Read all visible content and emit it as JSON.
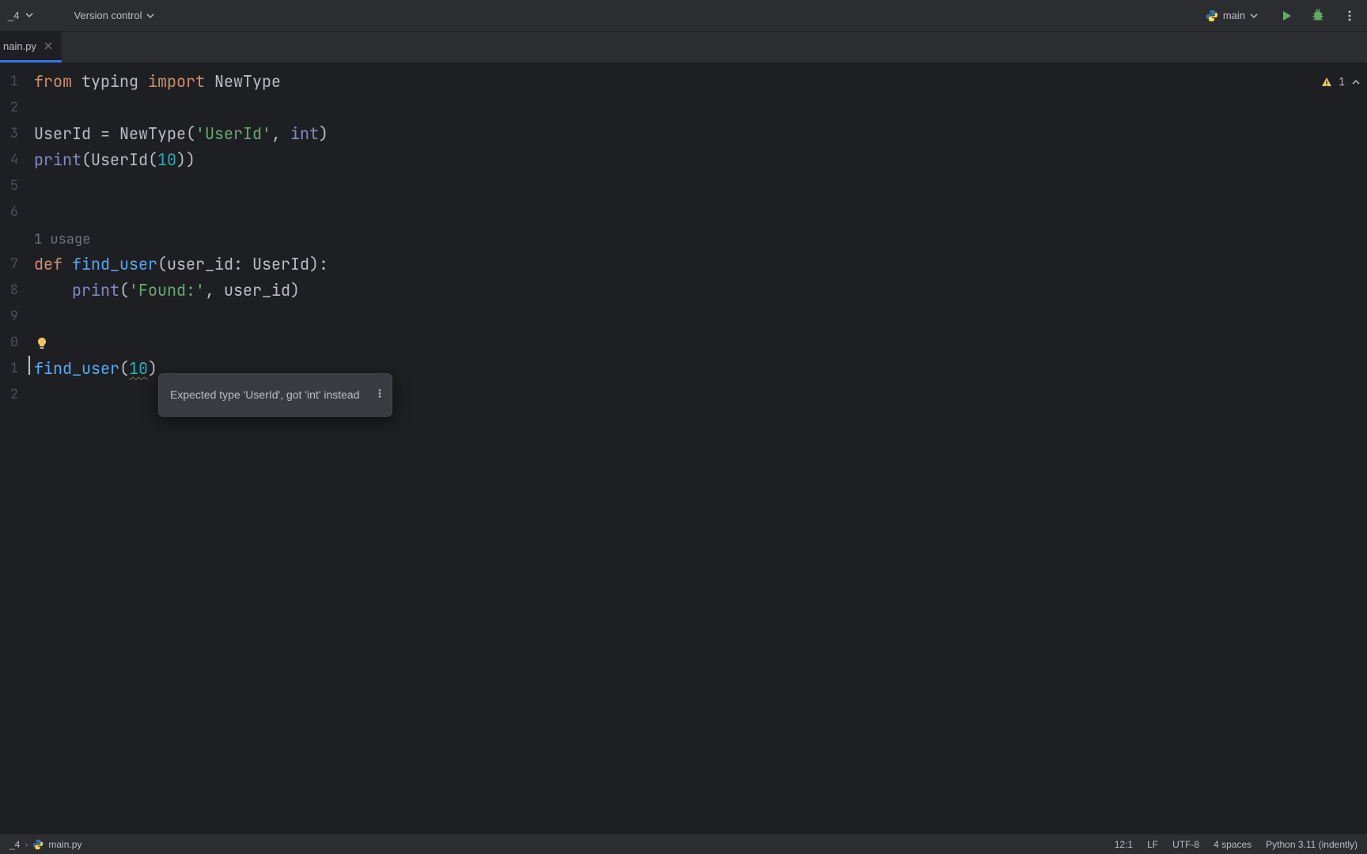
{
  "toolbar": {
    "project_suffix": "_4",
    "version_control": "Version control",
    "run_config": "main",
    "inspection_count": "1"
  },
  "tab": {
    "name": "nain.py",
    "full_name": "main.py"
  },
  "gutter_lines": [
    "1",
    "2",
    "3",
    "4",
    "5",
    "6",
    "",
    "7",
    "8",
    "9",
    "0",
    "1",
    "2"
  ],
  "code": {
    "l1": {
      "from": "from",
      "typing": "typing",
      "import": "import",
      "newtype": "NewType"
    },
    "l3": {
      "userid": "UserId",
      "eq_sp": " = ",
      "newtype_call": "NewType",
      "open": "(",
      "str": "'UserId'",
      "comma": ", ",
      "int": "int",
      "close": ")"
    },
    "l4": {
      "print": "print",
      "open": "(",
      "userid": "UserId",
      "open2": "(",
      "num": "10",
      "close": "))"
    },
    "usage_hint": "1 usage",
    "l7": {
      "def": "def",
      "sp": " ",
      "fn": "find_user",
      "open": "(",
      "param": "user_id",
      "colon_sp": ": ",
      "type": "UserId",
      "close": "):"
    },
    "l8": {
      "indent": "    ",
      "print": "print",
      "open": "(",
      "str": "'Found:'",
      "comma": ", ",
      "arg": "user_id",
      "close": ")"
    },
    "l11": {
      "fn": "find_user",
      "open": "(",
      "num": "10",
      "close": ")"
    }
  },
  "tooltip": {
    "text": "Expected type 'UserId', got 'int' instead"
  },
  "status": {
    "breadcrumb_project": "_4",
    "breadcrumb_file": "main.py",
    "cursor": "12:1",
    "line_sep": "LF",
    "encoding": "UTF-8",
    "indent": "4 spaces",
    "interpreter": "Python 3.11 (indently)"
  }
}
